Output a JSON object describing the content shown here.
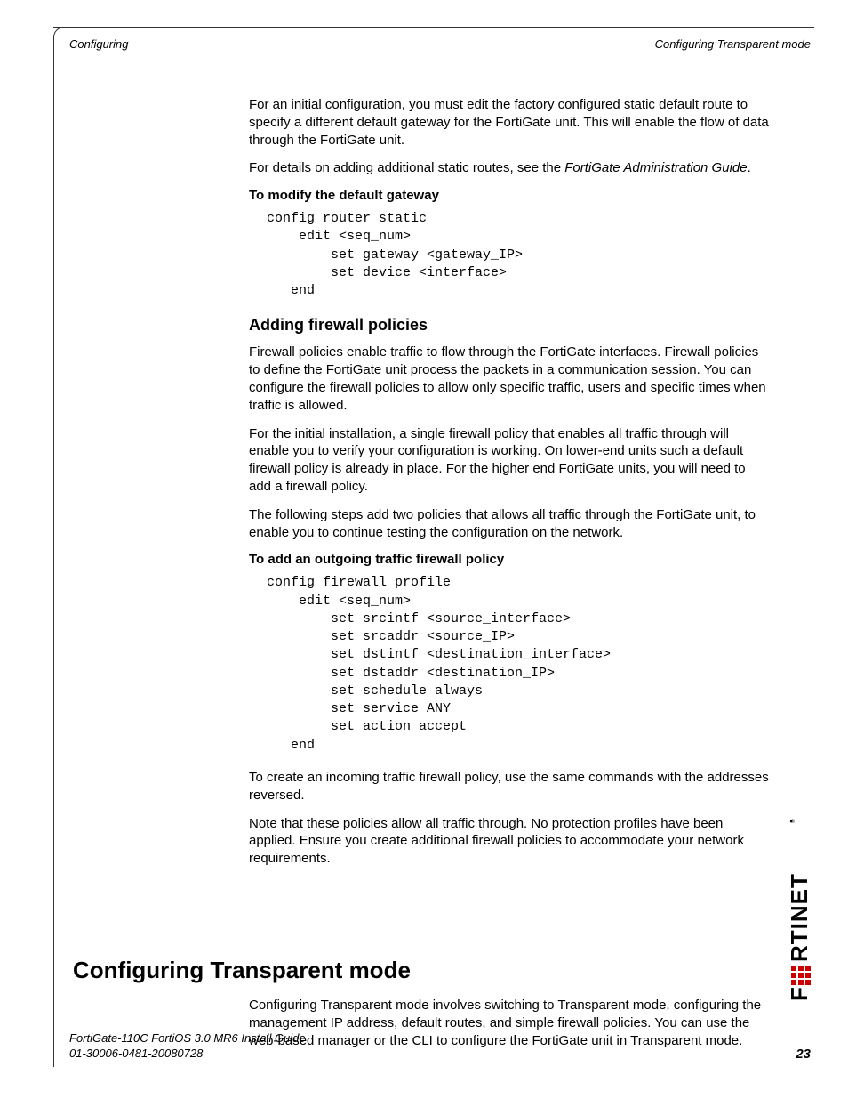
{
  "header": {
    "left": "Configuring",
    "right": "Configuring Transparent mode"
  },
  "intro": {
    "p1": "For an initial configuration, you must edit the factory configured static default route to specify a different default gateway for the FortiGate unit. This will enable the flow of data through the FortiGate unit.",
    "p2_a": "For details on adding additional static routes, see the ",
    "p2_i": "FortiGate Administration Guide",
    "p2_b": "."
  },
  "gateway": {
    "heading": "To modify the default gateway",
    "code": "config router static\n    edit <seq_num>\n        set gateway <gateway_IP>\n        set device <interface>\n   end"
  },
  "firewall": {
    "h3": "Adding firewall policies",
    "p1": "Firewall policies enable traffic to flow through the FortiGate interfaces. Firewall policies to define the FortiGate unit process the packets in a communication session. You can configure the firewall policies to allow only specific traffic, users and specific times when traffic is allowed.",
    "p2": "For the initial installation, a single firewall policy that enables all traffic through will enable you to verify your configuration is working. On lower-end units such a default firewall policy is already in place. For the higher end FortiGate units, you will need to add a firewall policy.",
    "p3": "The following steps add two policies that allows all traffic through the FortiGate unit, to enable you to continue testing the configuration on the network.",
    "heading": "To add an outgoing traffic firewall policy",
    "code": "config firewall profile\n    edit <seq_num>\n        set srcintf <source_interface>\n        set srcaddr <source_IP>\n        set dstintf <destination_interface>\n        set dstaddr <destination_IP>\n        set schedule always\n        set service ANY\n        set action accept\n   end",
    "p4": "To create an incoming traffic firewall policy, use the same commands with the addresses reversed.",
    "p5": "Note that these policies allow all traffic through. No protection profiles have been applied. Ensure you create additional firewall policies to accommodate your network requirements."
  },
  "transparent": {
    "h1": "Configuring Transparent mode",
    "p1": "Configuring Transparent mode involves switching to Transparent mode, configuring the management IP address, default routes, and simple firewall policies. You can use the web-based manager or the CLI to configure the FortiGate unit in Transparent mode."
  },
  "footer": {
    "line1": "FortiGate-110C FortiOS 3.0 MR6 Install Guide",
    "line2": "01-30006-0481-20080728",
    "pagenum": "23"
  },
  "logo": {
    "name": "fortinet-logo"
  }
}
